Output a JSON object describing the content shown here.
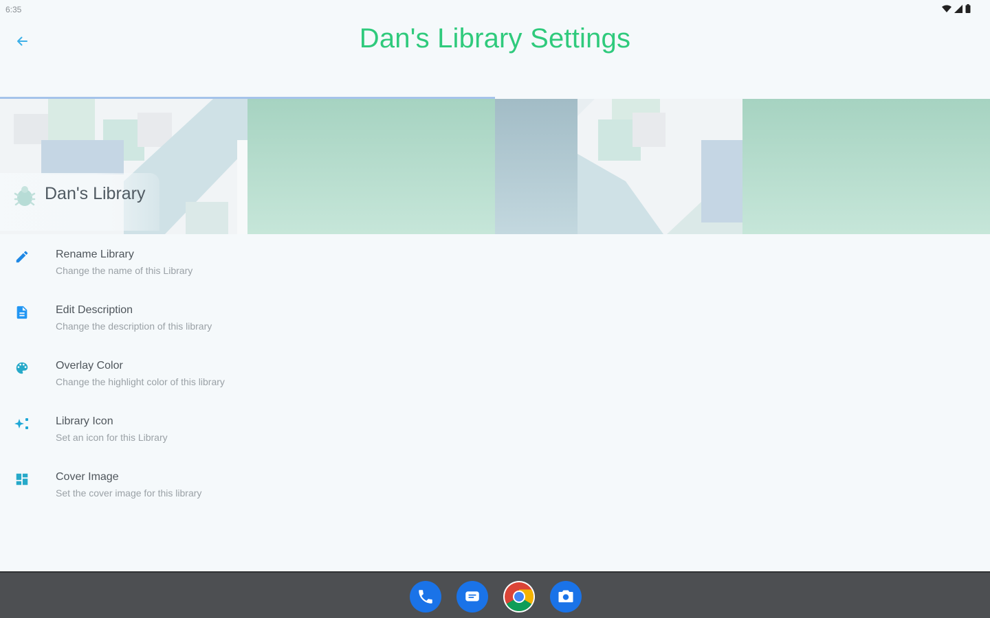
{
  "status_bar": {
    "time": "6:35"
  },
  "app_bar": {
    "title": "Dan's Library Settings"
  },
  "tabs": [
    {
      "label": "",
      "active": true
    },
    {
      "label": "",
      "active": false
    }
  ],
  "library": {
    "name": "Dan's Library"
  },
  "settings": [
    {
      "icon": "pencil-icon",
      "title": "Rename Library",
      "subtitle": "Change the name of this Library"
    },
    {
      "icon": "document-icon",
      "title": "Edit Description",
      "subtitle": "Change the description of this library"
    },
    {
      "icon": "palette-icon",
      "title": "Overlay Color",
      "subtitle": "Change the highlight color of this library"
    },
    {
      "icon": "sparkle-icon",
      "title": "Library Icon",
      "subtitle": "Set an icon for this Library"
    },
    {
      "icon": "dashboard-icon",
      "title": "Cover Image",
      "subtitle": "Set the cover image for this library"
    }
  ],
  "colors": {
    "title_green": "#2fca7c",
    "accent_blue": "#1e88e5",
    "background": "#f5f9fb",
    "nav_bar": "#4d4f52"
  },
  "dock": [
    "phone-icon",
    "messages-icon",
    "chrome-icon",
    "camera-icon"
  ]
}
